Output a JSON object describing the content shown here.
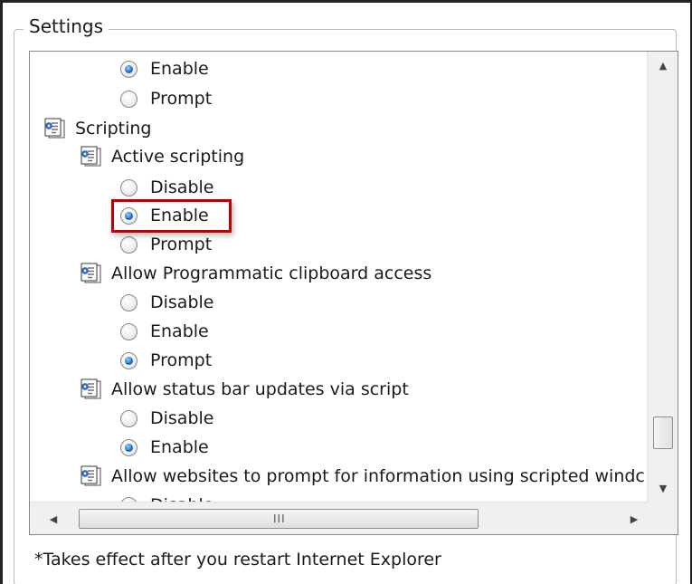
{
  "group_title": "Settings",
  "rows": [
    {
      "type": "radio",
      "label": "Enable",
      "checked": true
    },
    {
      "type": "radio",
      "label": "Prompt",
      "checked": false
    },
    {
      "type": "heading",
      "label": "Scripting",
      "icon": "settings-page-icon"
    },
    {
      "type": "heading",
      "label": "Active scripting",
      "icon": "settings-page-icon"
    },
    {
      "type": "radio",
      "label": "Disable",
      "checked": false
    },
    {
      "type": "radio",
      "label": "Enable",
      "checked": true
    },
    {
      "type": "radio",
      "label": "Prompt",
      "checked": false
    },
    {
      "type": "heading",
      "label": "Allow Programmatic clipboard access",
      "icon": "settings-page-icon"
    },
    {
      "type": "radio",
      "label": "Disable",
      "checked": false
    },
    {
      "type": "radio",
      "label": "Enable",
      "checked": false
    },
    {
      "type": "radio",
      "label": "Prompt",
      "checked": true
    },
    {
      "type": "heading",
      "label": "Allow status bar updates via script",
      "icon": "settings-page-icon"
    },
    {
      "type": "radio",
      "label": "Disable",
      "checked": false
    },
    {
      "type": "radio",
      "label": "Enable",
      "checked": true
    },
    {
      "type": "heading",
      "label": "Allow websites to prompt for information using scripted windc",
      "icon": "settings-page-icon"
    },
    {
      "type": "radio",
      "label": "Disable",
      "checked": false
    }
  ],
  "scrollbars": {
    "vertical": {
      "up_icon": "scroll-up-arrow-icon",
      "down_icon": "scroll-down-arrow-icon"
    },
    "horizontal": {
      "left_icon": "scroll-left-arrow-icon",
      "right_icon": "scroll-right-arrow-icon",
      "grip": "III"
    }
  },
  "highlight": {
    "row_index": 5,
    "color": "#c00000"
  },
  "footnote": "*Takes effect after you restart Internet Explorer"
}
